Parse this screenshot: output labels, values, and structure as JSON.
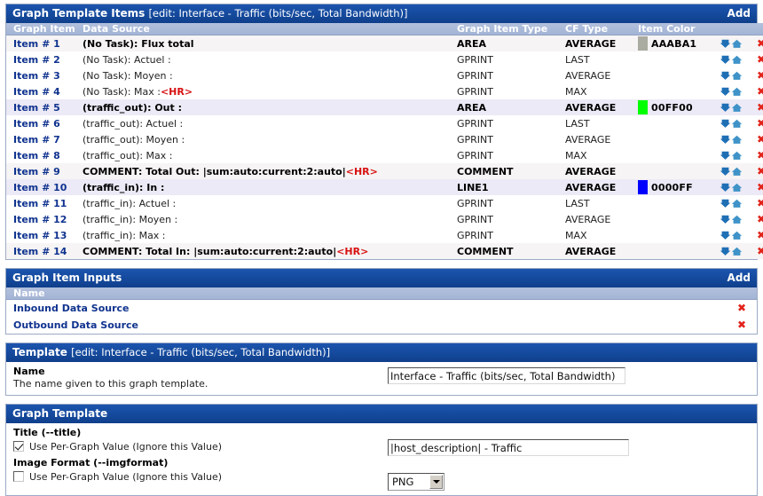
{
  "graph_template_items": {
    "title": "Graph Template Items",
    "subtitle": "[edit: Interface - Traffic (bits/sec, Total Bandwidth)]",
    "add_label": "Add",
    "columns": [
      "Graph Item",
      "Data Source",
      "Graph Item Type",
      "CF Type",
      "Item Color"
    ],
    "rows": [
      {
        "item": "Item # 1",
        "source": "(No Task): Flux total",
        "source_bold": true,
        "hr": false,
        "type": "AREA",
        "cf": "AVERAGE",
        "color_hex": "AAABA1",
        "color_label": "AAABA1",
        "shade": "even"
      },
      {
        "item": "Item # 2",
        "source": "(No Task): Actuel :",
        "source_bold": false,
        "hr": false,
        "type": "GPRINT",
        "cf": "LAST",
        "color_hex": "",
        "color_label": "",
        "shade": "odd"
      },
      {
        "item": "Item # 3",
        "source": "(No Task): Moyen :",
        "source_bold": false,
        "hr": false,
        "type": "GPRINT",
        "cf": "AVERAGE",
        "color_hex": "",
        "color_label": "",
        "shade": "odd"
      },
      {
        "item": "Item # 4",
        "source": "(No Task): Max :",
        "source_bold": false,
        "hr": true,
        "type": "GPRINT",
        "cf": "MAX",
        "color_hex": "",
        "color_label": "",
        "shade": "odd"
      },
      {
        "item": "Item # 5",
        "source": "(traffic_out): Out :",
        "source_bold": true,
        "hr": false,
        "type": "AREA",
        "cf": "AVERAGE",
        "color_hex": "00FF00",
        "color_label": "00FF00",
        "shade": "sel"
      },
      {
        "item": "Item # 6",
        "source": "(traffic_out): Actuel :",
        "source_bold": false,
        "hr": false,
        "type": "GPRINT",
        "cf": "LAST",
        "color_hex": "",
        "color_label": "",
        "shade": "odd"
      },
      {
        "item": "Item # 7",
        "source": "(traffic_out): Moyen :",
        "source_bold": false,
        "hr": false,
        "type": "GPRINT",
        "cf": "AVERAGE",
        "color_hex": "",
        "color_label": "",
        "shade": "odd"
      },
      {
        "item": "Item # 8",
        "source": "(traffic_out): Max :",
        "source_bold": false,
        "hr": false,
        "type": "GPRINT",
        "cf": "MAX",
        "color_hex": "",
        "color_label": "",
        "shade": "odd"
      },
      {
        "item": "Item # 9",
        "source": "COMMENT: Total Out: |sum:auto:current:2:auto|",
        "source_bold": true,
        "hr": true,
        "type": "COMMENT",
        "cf": "AVERAGE",
        "color_hex": "",
        "color_label": "",
        "shade": "even"
      },
      {
        "item": "Item # 10",
        "source": "(traffic_in): In :",
        "source_bold": true,
        "hr": false,
        "type": "LINE1",
        "cf": "AVERAGE",
        "color_hex": "0000FF",
        "color_label": "0000FF",
        "shade": "sel"
      },
      {
        "item": "Item # 11",
        "source": "(traffic_in): Actuel :",
        "source_bold": false,
        "hr": false,
        "type": "GPRINT",
        "cf": "LAST",
        "color_hex": "",
        "color_label": "",
        "shade": "odd"
      },
      {
        "item": "Item # 12",
        "source": "(traffic_in): Moyen :",
        "source_bold": false,
        "hr": false,
        "type": "GPRINT",
        "cf": "AVERAGE",
        "color_hex": "",
        "color_label": "",
        "shade": "odd"
      },
      {
        "item": "Item # 13",
        "source": "(traffic_in): Max :",
        "source_bold": false,
        "hr": false,
        "type": "GPRINT",
        "cf": "MAX",
        "color_hex": "",
        "color_label": "",
        "shade": "odd"
      },
      {
        "item": "Item # 14",
        "source": "COMMENT: Total In: |sum:auto:current:2:auto|",
        "source_bold": true,
        "hr": true,
        "type": "COMMENT",
        "cf": "AVERAGE",
        "color_hex": "",
        "color_label": "",
        "shade": "even"
      }
    ],
    "hr_text": "<HR>",
    "move_down_icon": "arrow-down-icon",
    "move_up_icon": "arrow-up-icon",
    "delete_icon": "delete-x-icon",
    "delete_glyph": "✖"
  },
  "graph_item_inputs": {
    "title": "Graph Item Inputs",
    "add_label": "Add",
    "column_name": "Name",
    "rows": [
      {
        "name": "Inbound Data Source"
      },
      {
        "name": "Outbound Data Source"
      }
    ]
  },
  "template_section": {
    "title": "Template",
    "subtitle": "[edit: Interface - Traffic (bits/sec, Total Bandwidth)]",
    "name_label": "Name",
    "name_desc": "The name given to this graph template.",
    "name_value": "Interface - Traffic (bits/sec, Total Bandwidth)"
  },
  "graph_template_section": {
    "title": "Graph Template",
    "fields": [
      {
        "label": "Title (--title)",
        "checkbox_label": "Use Per-Graph Value (Ignore this Value)",
        "checked": true,
        "value": "|host_description| - Traffic",
        "control": "text"
      },
      {
        "label": "Image Format (--imgformat)",
        "checkbox_label": "Use Per-Graph Value (Ignore this Value)",
        "checked": false,
        "value": "PNG",
        "control": "select"
      }
    ]
  },
  "colors": {
    "header_blue": "#14499c",
    "col_head": "#a8b8d8",
    "link_blue": "#10338f",
    "red": "#e2231a",
    "row_even": "#f6f4f4",
    "row_selected": "#eceaf6"
  }
}
